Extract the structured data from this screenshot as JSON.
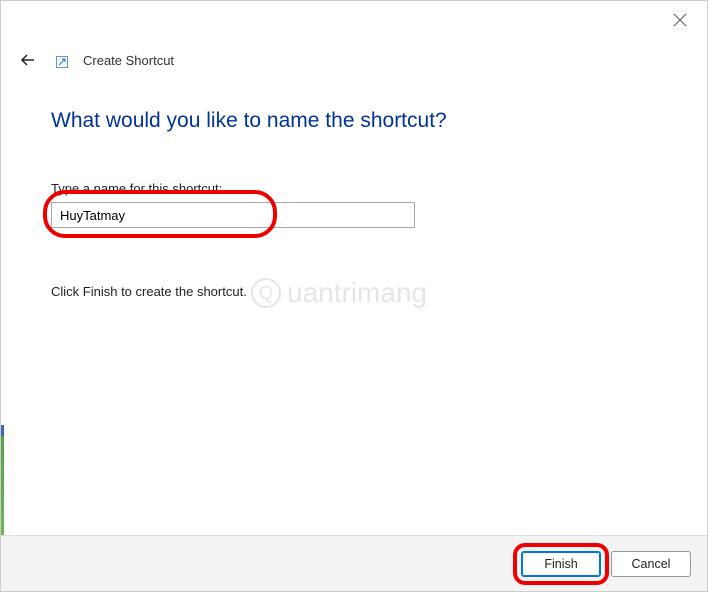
{
  "header": {
    "title": "Create Shortcut"
  },
  "main": {
    "heading": "What would you like to name the shortcut?",
    "input_label": "Type a name for this shortcut:",
    "input_value": "HuyTatmay",
    "instruction": "Click Finish to create the shortcut."
  },
  "footer": {
    "finish_label": "Finish",
    "cancel_label": "Cancel"
  },
  "watermark": {
    "text": "uantrimang"
  }
}
